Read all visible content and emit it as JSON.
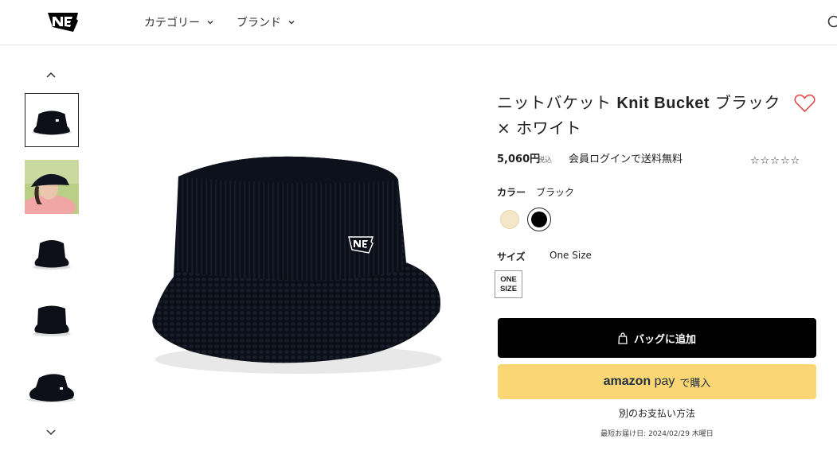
{
  "header": {
    "nav": [
      {
        "label": "カテゴリー"
      },
      {
        "label": "ブランド"
      }
    ]
  },
  "thumbnails": [
    {
      "name": "black-bucket-front",
      "selected": true
    },
    {
      "name": "model-wearing-hat",
      "selected": false
    },
    {
      "name": "black-bucket-side",
      "selected": false
    },
    {
      "name": "black-bucket-back",
      "selected": false
    },
    {
      "name": "black-bucket-top",
      "selected": false
    }
  ],
  "product": {
    "title_prefix": "ニットバケット ",
    "title_model": "Knit Bucket",
    "title_suffix": " ブラック × ホワイト",
    "price": "5,060円",
    "tax_label": "税込",
    "shipping_note": "会員ログインで送料無料",
    "rating_stars": "☆☆☆☆☆",
    "color_label": "カラー",
    "color_value": "ブラック",
    "colors": [
      "#f4e6c6",
      "#000000"
    ],
    "size_label": "サイズ",
    "size_value": "One Size",
    "size_box_line1": "ONE",
    "size_box_line2": "SIZE"
  },
  "actions": {
    "add_to_bag": "バッグに追加",
    "amazon_logo_a": "amazon",
    "amazon_logo_b": "pay",
    "amazon_suffix": "で購入",
    "other_payment": "別のお支払い方法",
    "delivery_note": "最短お届け日: 2024/02/29 木曜日"
  },
  "icons": {
    "logo": "new-era-flag-logo",
    "search": "search-icon",
    "heart": "heart-icon",
    "bag": "bag-icon"
  },
  "colors": {
    "heart": "#e24b4b",
    "primary_button": "#000000",
    "amazon_button": "#fad675"
  }
}
